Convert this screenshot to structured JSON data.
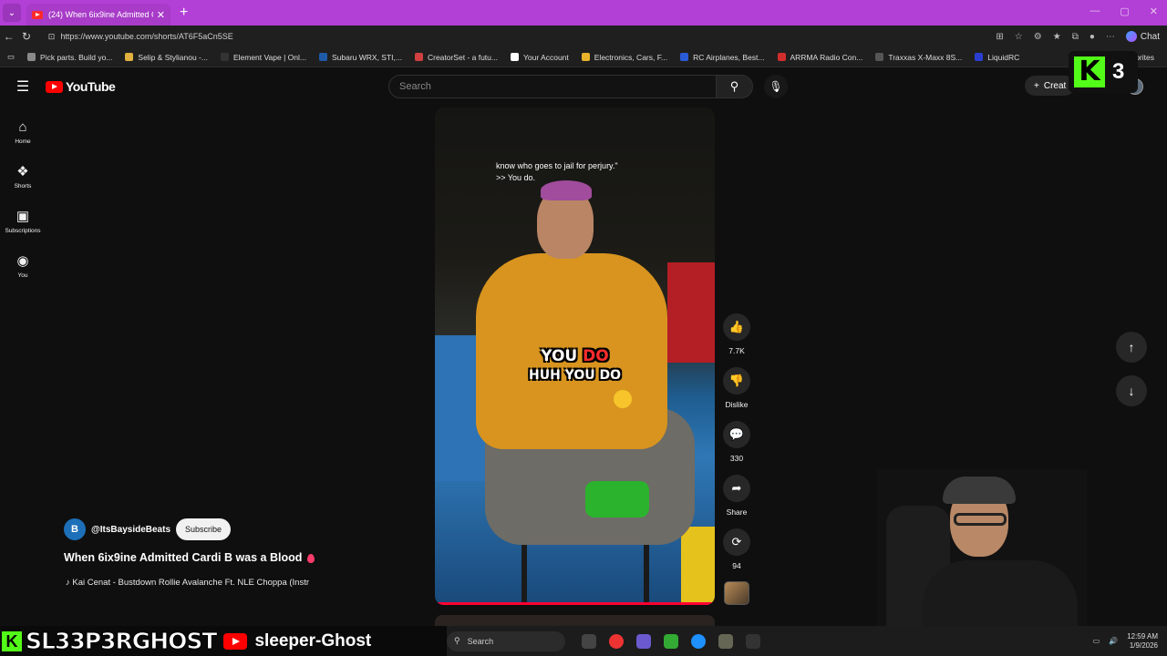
{
  "browser": {
    "tab_title": "(24) When 6ix9ine Admitted C",
    "tab_close": "✕",
    "new_tab": "+",
    "url": "https://www.youtube.com/shorts/AT6F5aCn5SE",
    "chat_label": "Chat",
    "bookmarks": [
      {
        "label": "Pick parts. Build yo...",
        "color": "#8a8a8a"
      },
      {
        "label": "Selip & Stylianou -...",
        "color": "#e0b040"
      },
      {
        "label": "Element Vape | Onl...",
        "color": "#333333"
      },
      {
        "label": "Subaru WRX, STI,...",
        "color": "#1e5aa8"
      },
      {
        "label": "CreatorSet - a futu...",
        "color": "#d04040"
      },
      {
        "label": "Your Account",
        "color": "#ffffff"
      },
      {
        "label": "Electronics, Cars, F...",
        "color": "#e8b32b"
      },
      {
        "label": "RC Airplanes, Best...",
        "color": "#2a5bd7"
      },
      {
        "label": "ARRMA Radio Con...",
        "color": "#d22d2d"
      },
      {
        "label": "Traxxas X-Maxx 8S...",
        "color": "#555555"
      },
      {
        "label": "LiquidRC",
        "color": "#2a3fd0"
      }
    ],
    "favorites_partial": "orites"
  },
  "youtube": {
    "logo_text": "YouTube",
    "search_placeholder": "Search",
    "create_label": "Creat",
    "rail": [
      {
        "label": "Home",
        "icon": "home-icon",
        "glyph": "⌂"
      },
      {
        "label": "Shorts",
        "icon": "shorts-icon",
        "glyph": "❖"
      },
      {
        "label": "Subscriptions",
        "icon": "subscriptions-icon",
        "glyph": "▣"
      },
      {
        "label": "You",
        "icon": "you-icon",
        "glyph": "◉"
      }
    ]
  },
  "kick_badge": {
    "letter": "K",
    "count": "3"
  },
  "short": {
    "caption_top_line1": "know who goes to jail for perjury.\"",
    "caption_top_line2": ">> You do.",
    "caption_big_1a": "YOU ",
    "caption_big_1b": "DO",
    "caption_big_2": "HUH YOU DO",
    "channel_initial": "B",
    "channel": "@ItsBaysideBeats",
    "subscribe": "Subscribe",
    "title": "When 6ix9ine Admitted Cardi B was a Blood",
    "music": "♪ Kai Cenat - Bustdown Rollie Avalanche Ft. NLE Choppa (Instr"
  },
  "actions": {
    "likes": "7.7K",
    "dislike": "Dislike",
    "comments": "330",
    "share": "Share",
    "remix": "94"
  },
  "overlay": {
    "kick_letter": "K",
    "stream_name": "SL33P3RGHOST",
    "yt_channel": "sleeper-Ghost"
  },
  "taskbar": {
    "search": "Search",
    "time": "12:59 AM",
    "date": "1/9/2026"
  }
}
